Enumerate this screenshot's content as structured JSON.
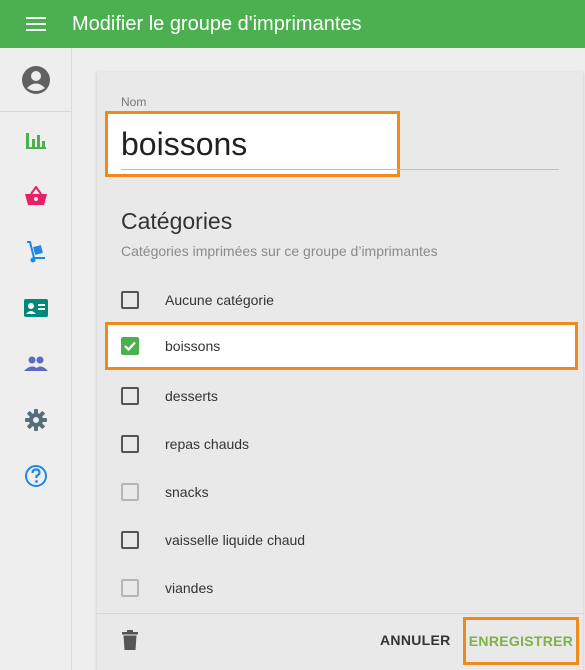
{
  "appbar": {
    "menu_icon": "hamburger-menu-icon",
    "title": "Modifier le groupe d'imprimantes",
    "color": "#4caf50"
  },
  "sidebar": {
    "avatar_icon": "account-circle-icon",
    "items": [
      {
        "icon": "bar-chart-icon",
        "color": "#4caf50"
      },
      {
        "icon": "shopping-basket-icon",
        "color": "#e91e63"
      },
      {
        "icon": "hand-truck-icon",
        "color": "#1e88e5"
      },
      {
        "icon": "contact-card-icon",
        "color": "#00897b"
      },
      {
        "icon": "people-icon",
        "color": "#5c6bc0"
      },
      {
        "icon": "settings-gear-icon",
        "color": "#546e7a"
      },
      {
        "icon": "help-circle-icon",
        "color": "#1e88e5"
      }
    ]
  },
  "form": {
    "name_label": "Nom",
    "name_value": "boissons",
    "categories_title": "Catégories",
    "categories_subtitle": "Catégories imprimées sur ce groupe d’imprimantes",
    "categories": [
      {
        "label": "Aucune catégorie",
        "checked": false,
        "disabled": false
      },
      {
        "label": "boissons",
        "checked": true,
        "disabled": false
      },
      {
        "label": "desserts",
        "checked": false,
        "disabled": false
      },
      {
        "label": "repas chauds",
        "checked": false,
        "disabled": false
      },
      {
        "label": "snacks",
        "checked": false,
        "disabled": true
      },
      {
        "label": "vaisselle liquide chaud",
        "checked": false,
        "disabled": false
      },
      {
        "label": "viandes",
        "checked": false,
        "disabled": true
      }
    ]
  },
  "footer": {
    "delete_icon": "trash-icon",
    "cancel_label": "ANNULER",
    "save_label": "ENREGISTRER",
    "save_color": "#7cb342",
    "highlight_color": "#f08a1c"
  }
}
